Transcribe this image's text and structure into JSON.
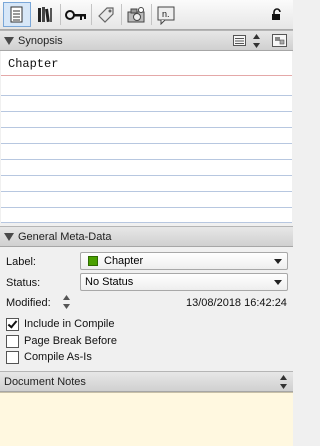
{
  "toolbar": {
    "buttons": [
      {
        "icon": "index-card-icon",
        "active": true
      },
      {
        "icon": "books-icon",
        "active": false
      },
      {
        "icon": "key-icon",
        "active": false
      },
      {
        "icon": "tag-icon",
        "active": false
      },
      {
        "icon": "snapshot-camera-icon",
        "active": false
      },
      {
        "icon": "comment-note-icon",
        "text": "n.",
        "active": false
      }
    ],
    "lock_icon": "lock-icon"
  },
  "synopsis": {
    "title": "Synopsis",
    "card_text": "Chapter"
  },
  "metadata": {
    "title": "General Meta-Data",
    "label_caption": "Label:",
    "label_value": "Chapter",
    "label_color": "#4aa000",
    "status_caption": "Status:",
    "status_value": "No Status",
    "modified_caption": "Modified:",
    "modified_value": "13/08/2018 16:42:24",
    "checkboxes": [
      {
        "label": "Include in Compile",
        "checked": true
      },
      {
        "label": "Page Break Before",
        "checked": false
      },
      {
        "label": "Compile As-Is",
        "checked": false
      }
    ]
  },
  "notes": {
    "title": "Document Notes"
  }
}
